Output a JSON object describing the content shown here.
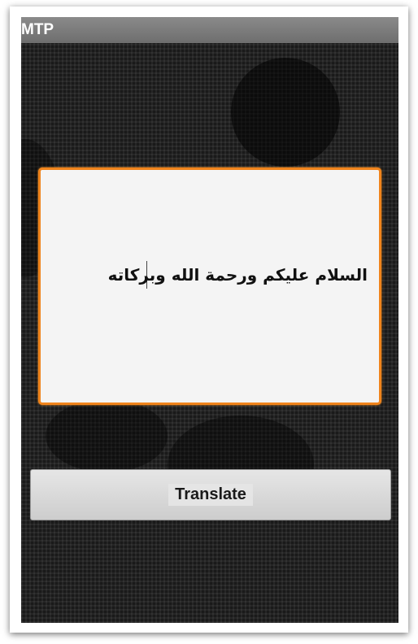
{
  "app": {
    "title": "MTP"
  },
  "input": {
    "value": "السلام عليكم ورحمة الله وبركاته"
  },
  "buttons": {
    "translate_label": "Translate"
  },
  "colors": {
    "accent": "#f0841c",
    "titlebar": "#7a7a7a",
    "background": "#1a1a1a"
  }
}
